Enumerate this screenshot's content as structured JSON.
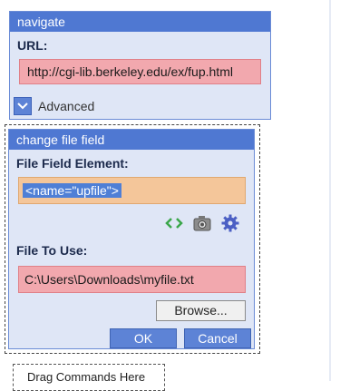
{
  "navigate": {
    "title": "navigate",
    "url_label": "URL:",
    "url_value": "http://cgi-lib.berkeley.edu/ex/fup.html",
    "advanced_label": "Advanced"
  },
  "file_field": {
    "title": "change file field",
    "element_label": "File Field Element:",
    "element_value": "<name=\"upfile\">",
    "file_label": "File To Use:",
    "file_value": "C:\\Users\\Downloads\\myfile.txt",
    "browse_label": "Browse...",
    "ok_label": "OK",
    "cancel_label": "Cancel",
    "icons": [
      "code-brackets-icon",
      "camera-icon",
      "gear-icon"
    ]
  },
  "drag_target": {
    "label": "Drag Commands Here"
  },
  "colors": {
    "title_bar": "#4f78d2",
    "panel_bg": "#dfe6f6",
    "error_field": "#f2a8ae",
    "warning_field": "#f4c69a",
    "button_blue": "#5d83d6"
  }
}
